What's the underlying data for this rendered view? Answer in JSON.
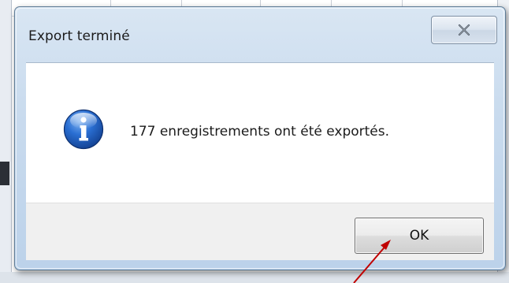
{
  "dialog": {
    "title": "Export terminé",
    "close_icon": "close-x-icon",
    "message": "177 enregistrements ont été exportés.",
    "icon": "info-icon",
    "ok_label": "OK"
  },
  "annotation": {
    "arrow_color": "#c00000",
    "target": "ok-button"
  },
  "colors": {
    "titlebar": "#c9dbee",
    "content_bg": "#ffffff",
    "footer_bg": "#f0f0f0",
    "info_icon_blue": "#1f5fbf"
  }
}
